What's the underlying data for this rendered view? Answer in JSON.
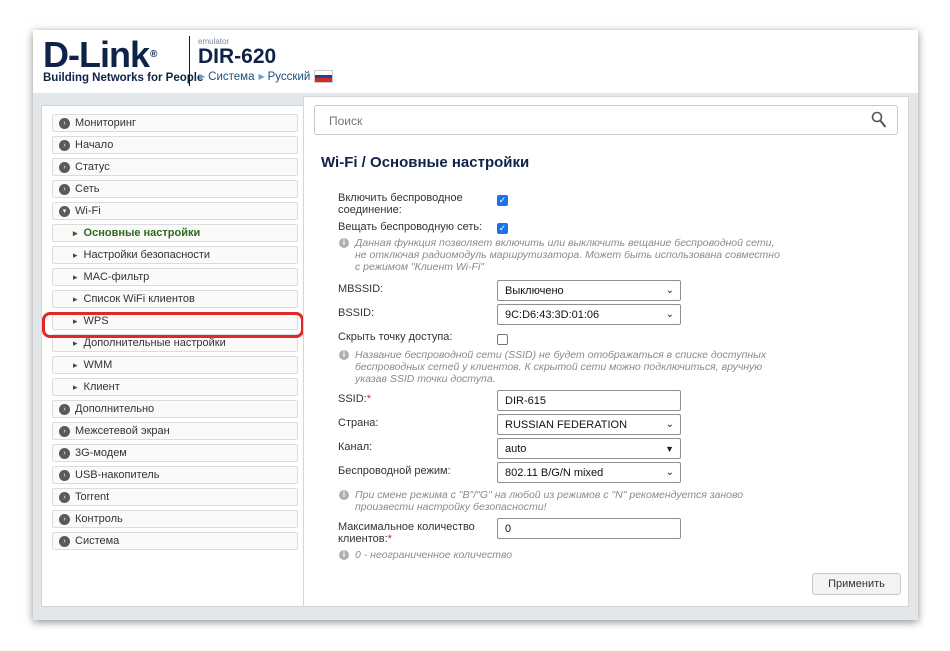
{
  "header": {
    "logo_text": "D-Link",
    "logo_reg": "®",
    "tagline": "Building Networks for People",
    "emulator_label": "emulator",
    "model": "DIR-620",
    "link_system": "Система",
    "link_language": "Русский",
    "flag_colors": [
      "#ffffff",
      "#1c3fa8",
      "#d52b1e"
    ]
  },
  "sidebar": {
    "items": [
      {
        "label": "Мониторинг",
        "icon": "chevron-circle-right-icon"
      },
      {
        "label": "Начало",
        "icon": "chevron-circle-right-icon"
      },
      {
        "label": "Статус",
        "icon": "chevron-circle-right-icon"
      },
      {
        "label": "Сеть",
        "icon": "chevron-circle-right-icon"
      },
      {
        "label": "Wi-Fi",
        "icon": "chevron-circle-down-icon",
        "expanded": true
      },
      {
        "label": "Основные настройки",
        "sub": true,
        "active": true
      },
      {
        "label": "Настройки безопасности",
        "sub": true
      },
      {
        "label": "MAC-фильтр",
        "sub": true
      },
      {
        "label": "Список WiFi клиентов",
        "sub": true
      },
      {
        "label": "WPS",
        "sub": true,
        "highlighted": true
      },
      {
        "label": "Дополнительные настройки",
        "sub": true
      },
      {
        "label": "WMM",
        "sub": true
      },
      {
        "label": "Клиент",
        "sub": true
      },
      {
        "label": "Дополнительно",
        "icon": "chevron-circle-right-icon"
      },
      {
        "label": "Межсетевой экран",
        "icon": "chevron-circle-right-icon"
      },
      {
        "label": "3G-модем",
        "icon": "chevron-circle-right-icon"
      },
      {
        "label": "USB-накопитель",
        "icon": "chevron-circle-right-icon"
      },
      {
        "label": "Torrent",
        "icon": "chevron-circle-right-icon"
      },
      {
        "label": "Контроль",
        "icon": "chevron-circle-right-icon"
      },
      {
        "label": "Система",
        "icon": "chevron-circle-right-icon"
      }
    ],
    "highlight_color": "#e32626"
  },
  "search": {
    "placeholder": "Поиск"
  },
  "page": {
    "title": "Wi-Fi /  Основные настройки"
  },
  "form": {
    "enable_wireless_label": "Включить беспроводное соединение:",
    "enable_wireless_checked": true,
    "broadcast_label": "Вещать беспроводную сеть:",
    "broadcast_checked": true,
    "broadcast_hint": "Данная функция позволяет включить или выключить вещание беспроводной сети, не отключая радиомодуль маршрутизатора. Может быть использована совместно с режимом \"Клиент Wi-Fi\"",
    "mbssid_label": "MBSSID:",
    "mbssid_value": "Выключено",
    "bssid_label": "BSSID:",
    "bssid_value": "9C:D6:43:3D:01:06",
    "hide_ap_label": "Скрыть точку доступа:",
    "hide_ap_checked": false,
    "hide_ap_hint": "Название беспроводной сети (SSID) не будет отображаться в списке доступных беспроводных сетей у клиентов. К скрытой сети можно подключиться, вручную указав SSID точки доступа.",
    "ssid_label": "SSID:",
    "ssid_required": "*",
    "ssid_value": "DIR-615",
    "country_label": "Страна:",
    "country_value": "RUSSIAN FEDERATION",
    "channel_label": "Канал:",
    "channel_value": "auto",
    "mode_label": "Беспроводной режим:",
    "mode_value": "802.11 B/G/N mixed",
    "mode_hint": "При смене режима с \"B\"/\"G\" на любой из режимов с \"N\" рекомендуется заново произвести настройку безопасности!",
    "max_clients_label": "Максимальное количество клиентов:",
    "max_clients_required": "*",
    "max_clients_value": "0",
    "max_clients_hint": "0 - неограниченное количество",
    "apply_label": "Применить",
    "accent_color": "#1a73e8"
  }
}
